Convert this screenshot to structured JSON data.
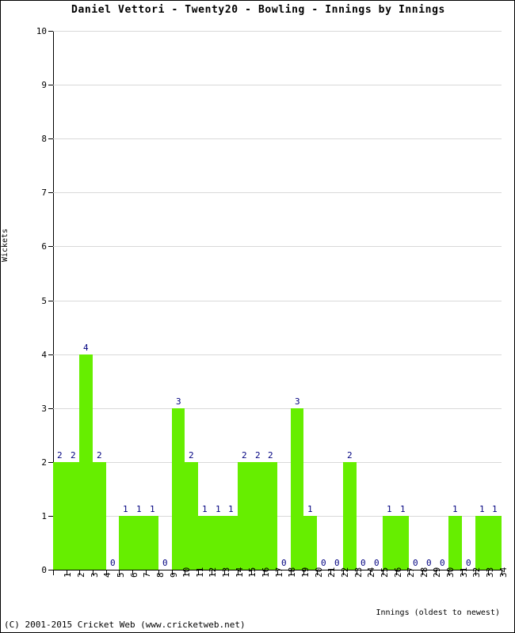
{
  "chart_data": {
    "type": "bar",
    "title": "Daniel Vettori - Twenty20 - Bowling - Innings by Innings",
    "xlabel": "Innings (oldest to newest)",
    "ylabel": "Wickets",
    "ylim": [
      0,
      10
    ],
    "yticks": [
      0,
      1,
      2,
      3,
      4,
      5,
      6,
      7,
      8,
      9,
      10
    ],
    "grid": true,
    "legend": null,
    "bar_color": "#66ee00",
    "label_color": "#000080",
    "categories": [
      "1",
      "2",
      "3",
      "4",
      "5",
      "6",
      "7",
      "8",
      "9",
      "10",
      "11",
      "12",
      "13",
      "14",
      "15",
      "16",
      "17",
      "18",
      "19",
      "20",
      "21",
      "22",
      "23",
      "24",
      "25",
      "26",
      "27",
      "28",
      "29",
      "30",
      "31",
      "32",
      "33",
      "34"
    ],
    "values": [
      2,
      2,
      4,
      2,
      0,
      1,
      1,
      1,
      0,
      3,
      2,
      1,
      1,
      1,
      2,
      2,
      2,
      0,
      3,
      1,
      0,
      0,
      2,
      0,
      0,
      1,
      1,
      0,
      0,
      0,
      1,
      0,
      1,
      1
    ],
    "point_labels": [
      "2",
      "2",
      "4",
      "2",
      "0",
      "1",
      "1",
      "1",
      "0",
      "3",
      "2",
      "1",
      "1",
      "1",
      "2",
      "2",
      "2",
      "0",
      "3",
      "1",
      "0",
      "0",
      "2",
      "0",
      "0",
      "1",
      "1",
      "0",
      "0",
      "0",
      "1",
      "0",
      "1",
      "1"
    ]
  },
  "footer": {
    "copyright": "(C) 2001-2015 Cricket Web (www.cricketweb.net)"
  }
}
